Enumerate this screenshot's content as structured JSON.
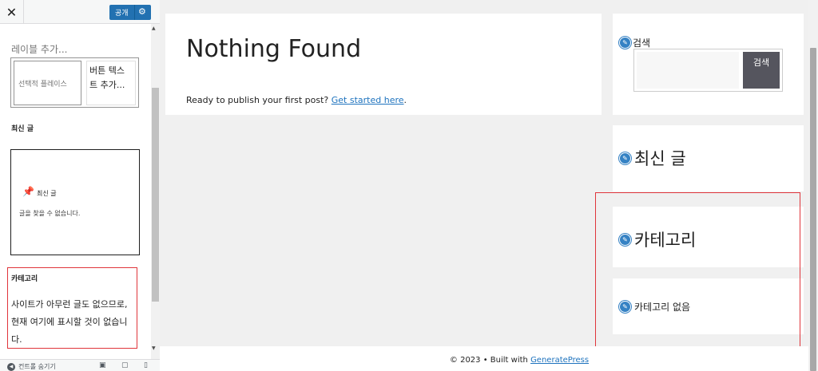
{
  "panel": {
    "close_icon": "✕",
    "publish_label": "공개",
    "label_add": "레이블 추가...",
    "search_preview": {
      "placeholder": "선택적 플레이스",
      "button": "버튼 텍스트 추가..."
    },
    "recent_heading": "최신 글",
    "recent_preview": {
      "title": "최신 글",
      "empty": "글을 찾을 수 없습니다."
    },
    "category": {
      "heading": "카테고리",
      "message": "사이트가 아무런 글도 없으므로, 현재 여기에 표시할 것이 없습니다."
    },
    "footer": {
      "hide_controls": "컨트롤 숨기기"
    }
  },
  "preview": {
    "content": {
      "title": "Nothing Found",
      "text": "Ready to publish your first post?",
      "link": "Get started here",
      "after": "."
    },
    "widgets": {
      "search_title": "검색",
      "search_button": "검색",
      "recent_title": "최신 글",
      "category_title": "카테고리",
      "category_empty": "카테고리 없음"
    },
    "footer": {
      "text": "© 2023 • Built with",
      "link": "GeneratePress"
    }
  },
  "colors": {
    "accent": "#2271b1",
    "highlight": "#e0353b",
    "link": "#1e73be"
  },
  "icons": [
    "close-icon",
    "gear-icon",
    "pin-icon",
    "pencil-icon",
    "desktop-icon",
    "tablet-icon",
    "mobile-icon",
    "collapse-icon"
  ]
}
